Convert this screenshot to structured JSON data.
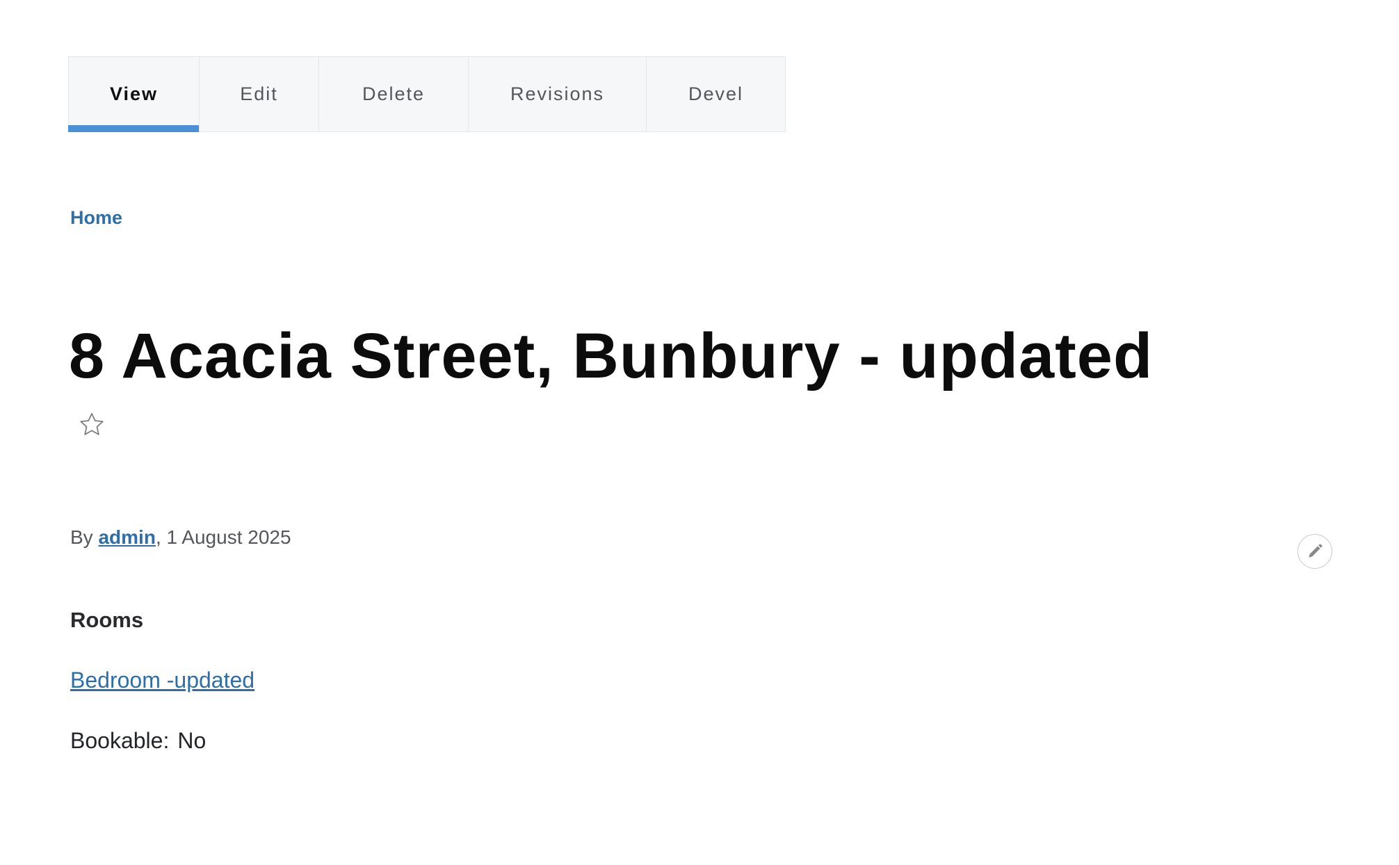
{
  "tabs": [
    {
      "label": "View",
      "active": true
    },
    {
      "label": "Edit",
      "active": false
    },
    {
      "label": "Delete",
      "active": false
    },
    {
      "label": "Revisions",
      "active": false
    },
    {
      "label": "Devel",
      "active": false
    }
  ],
  "breadcrumb": {
    "home": "Home"
  },
  "title": "8 Acacia Street, Bunbury - updated",
  "favorite_icon": "star-outline-icon",
  "byline": {
    "prefix": "By",
    "author": "admin",
    "date": ", 1 August 2025"
  },
  "contextual_icon": "pencil-icon",
  "rooms": {
    "label": "Rooms",
    "items": [
      "Bedroom -updated"
    ]
  },
  "bookable": {
    "label": "Bookable:",
    "value": "No"
  },
  "colors": {
    "link": "#2f6ea8",
    "active_tab_underline": "#4a90d9",
    "tab_background": "#f5f7f8"
  }
}
